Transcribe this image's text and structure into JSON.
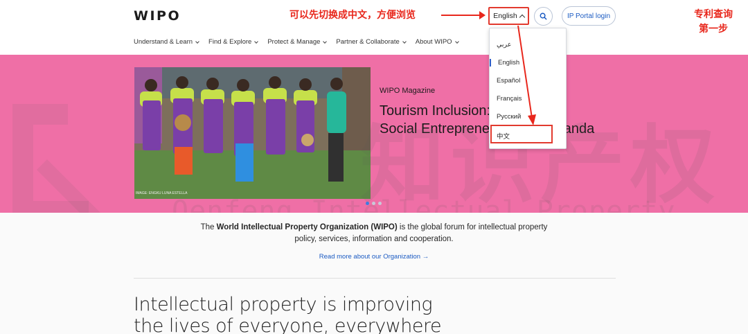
{
  "header": {
    "logo": "WIPO",
    "language_button": "English",
    "portal_button": "IP Portal login"
  },
  "annotations": {
    "top_note": "可以先切换成中文，方便浏览",
    "right_note_line1": "专利查询",
    "right_note_line2": "第一步"
  },
  "nav": {
    "items": [
      {
        "label": "Understand & Learn"
      },
      {
        "label": "Find & Explore"
      },
      {
        "label": "Protect & Manage"
      },
      {
        "label": "Partner & Collaborate"
      },
      {
        "label": "About WIPO"
      }
    ]
  },
  "language_menu": {
    "options": [
      "عربي",
      "English",
      "Español",
      "Français",
      "Русский",
      "中文"
    ],
    "selected": "English"
  },
  "hero": {
    "magazine_label": "WIPO Magazine",
    "title_line1": "Tourism Inclusion: Fostering",
    "title_line2": "Social Entrepreneurship in Uganda",
    "photo_credit": "IMAGE: ENGKU LUNA ESTELLA"
  },
  "watermark": {
    "cn": "知识产权",
    "en": "Qenfeng Intellectual Property"
  },
  "intro": {
    "pre": "The ",
    "org": "World Intellectual Property Organization (WIPO)",
    "post": " is the global forum for intellectual property policy, services, information and cooperation.",
    "read_more": "Read more about our Organization →"
  },
  "section": {
    "headline": "Intellectual property is improving the lives of everyone, everywhere"
  },
  "colors": {
    "hero_bg": "#ef6fa6",
    "annotation_red": "#e8271c",
    "link_blue": "#1a5ac2"
  }
}
